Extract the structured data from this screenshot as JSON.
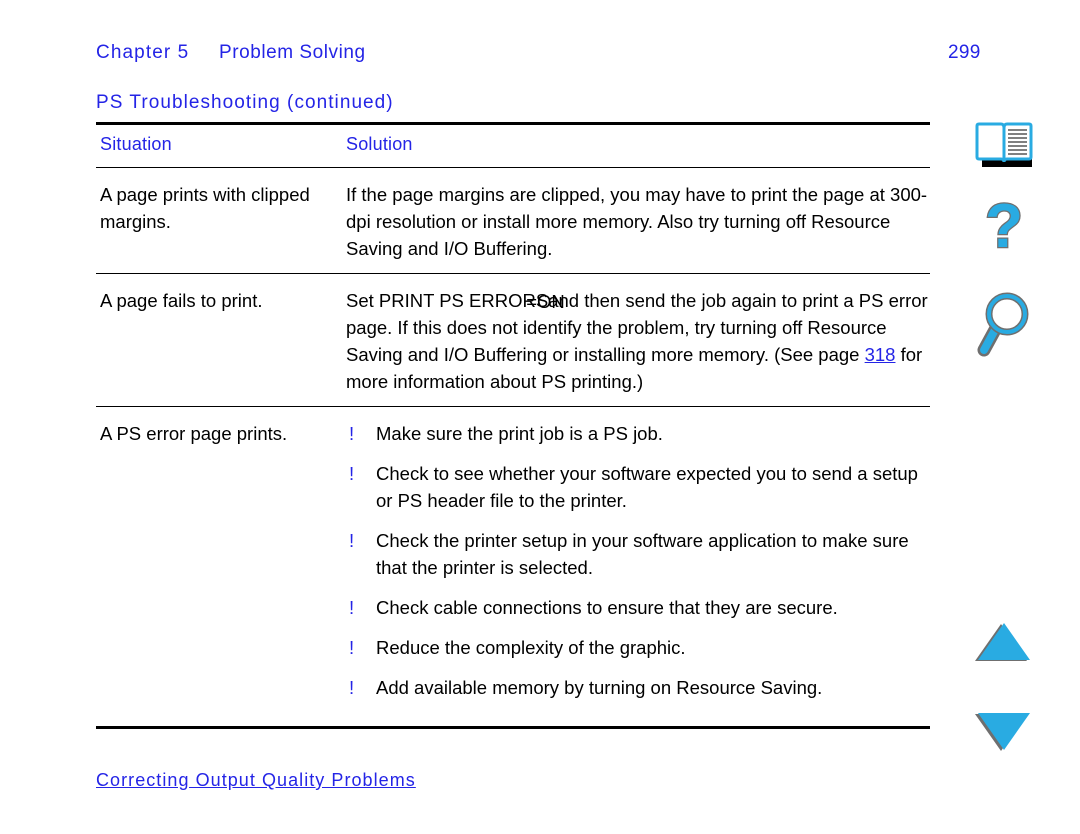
{
  "header": {
    "chapter_label": "Chapter 5",
    "chapter_title": "Problem Solving",
    "page_number": "299"
  },
  "table": {
    "caption": "PS Troubleshooting (continued)",
    "columns": [
      {
        "label": "Situation"
      },
      {
        "label": "Solution"
      }
    ],
    "rows": [
      {
        "situation": "A page prints with clipped margins.",
        "solution_paragraphs": [
          "If the page margins are clipped, you may have to print the page at 300-dpi resolution or install more memory. Also try turning off Resource Saving and I/O Buffering."
        ]
      },
      {
        "situation": "A page fails to print.",
        "solution_prefix": "Set PRINT PS ERRORS",
        "solution_overlap": "=ON",
        "solution_rest": "and then send the job again to print a PS error page. If this does not identify the problem, try turning off Resource Saving and I/O Buffering or installing more memory. (See page ",
        "solution_link": "318",
        "solution_tail": " for more information about PS printing.)"
      },
      {
        "situation": "A PS error page prints.",
        "bullet_char": "!",
        "bullets": [
          "Make sure the print job is a PS job.",
          "Check to see whether your software expected you to send a setup or PS header file to the printer.",
          "Check the printer setup in your software application to make sure that the printer is selected.",
          "Check cable connections to ensure that they are secure.",
          "Reduce the complexity of the graphic.",
          "Add available memory by turning on Resource Saving."
        ]
      }
    ]
  },
  "footer": {
    "section_link": "Correcting Output Quality Problems"
  },
  "nav_rail": {
    "items": [
      {
        "name": "book-icon",
        "tooltip": "Contents"
      },
      {
        "name": "question-mark-icon",
        "tooltip": "Help"
      },
      {
        "name": "magnifying-glass-icon",
        "tooltip": "Search"
      },
      {
        "name": "triangle-up-icon",
        "tooltip": "Previous page"
      },
      {
        "name": "triangle-down-icon",
        "tooltip": "Next page"
      }
    ]
  },
  "colors": {
    "link_blue": "#2424e6",
    "icon_cyan": "#29abe2",
    "icon_shadow": "#6f6f6f",
    "rule_black": "#000000"
  }
}
